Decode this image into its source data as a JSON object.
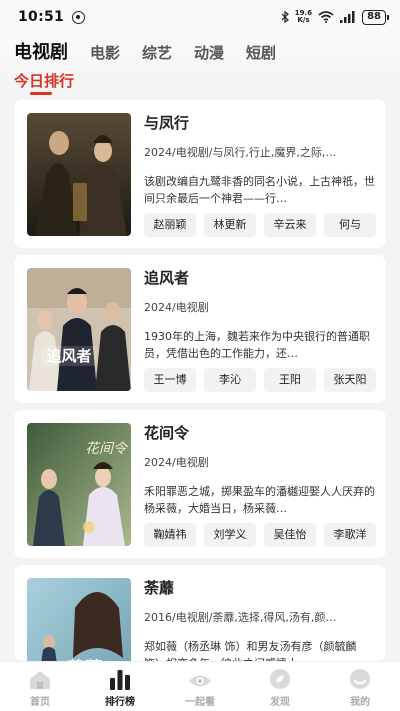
{
  "status": {
    "time": "10:51",
    "net_speed_value": "19.6",
    "net_speed_unit": "K/s",
    "battery": "88"
  },
  "tabs": [
    {
      "label": "电视剧",
      "active": true
    },
    {
      "label": "电影",
      "active": false
    },
    {
      "label": "综艺",
      "active": false
    },
    {
      "label": "动漫",
      "active": false
    },
    {
      "label": "短剧",
      "active": false
    }
  ],
  "subtab": "今日排行",
  "cards": [
    {
      "title": "与凤行",
      "meta": "2024/电视剧/与凤行,行止,魔界,之际,…",
      "desc": "该剧改编自九鹭非香的同名小说，上古神祇，世间只余最后一个神君——行…",
      "cast": [
        "赵丽颖",
        "林更新",
        "辛云来",
        "何与"
      ]
    },
    {
      "title": "追风者",
      "meta": "2024/电视剧",
      "desc": "1930年的上海，魏若来作为中央银行的普通职员，凭借出色的工作能力，还…",
      "cast": [
        "王一博",
        "李沁",
        "王阳",
        "张天阳"
      ]
    },
    {
      "title": "花间令",
      "meta": "2024/电视剧",
      "desc": "禾阳罪恶之城，掷果盈车的潘樾迎娶人人厌弃的杨采薇，大婚当日，杨采薇…",
      "cast": [
        "鞠婧祎",
        "刘学义",
        "吴佳怡",
        "李歌洋"
      ]
    },
    {
      "title": "荼蘼",
      "meta": "2016/电视剧/荼蘼,选择,得风,汤有,颜…",
      "desc": "郑如薇（杨丞琳 饰）和男友汤有彦（颜毓麟 饰）相恋多年，彼此之间感情十…",
      "cast": []
    }
  ],
  "bottom_nav": [
    {
      "label": "首页",
      "icon": "home-icon",
      "active": false
    },
    {
      "label": "排行榜",
      "icon": "ranking-icon",
      "active": true
    },
    {
      "label": "一起看",
      "icon": "eye-icon",
      "active": false
    },
    {
      "label": "发现",
      "icon": "discover-icon",
      "active": false
    },
    {
      "label": "我的",
      "icon": "profile-icon",
      "active": false
    }
  ],
  "colors": {
    "accent": "#d8352a",
    "background": "#f3f3f3",
    "card": "#ffffff",
    "chip": "#f2f2f2"
  }
}
